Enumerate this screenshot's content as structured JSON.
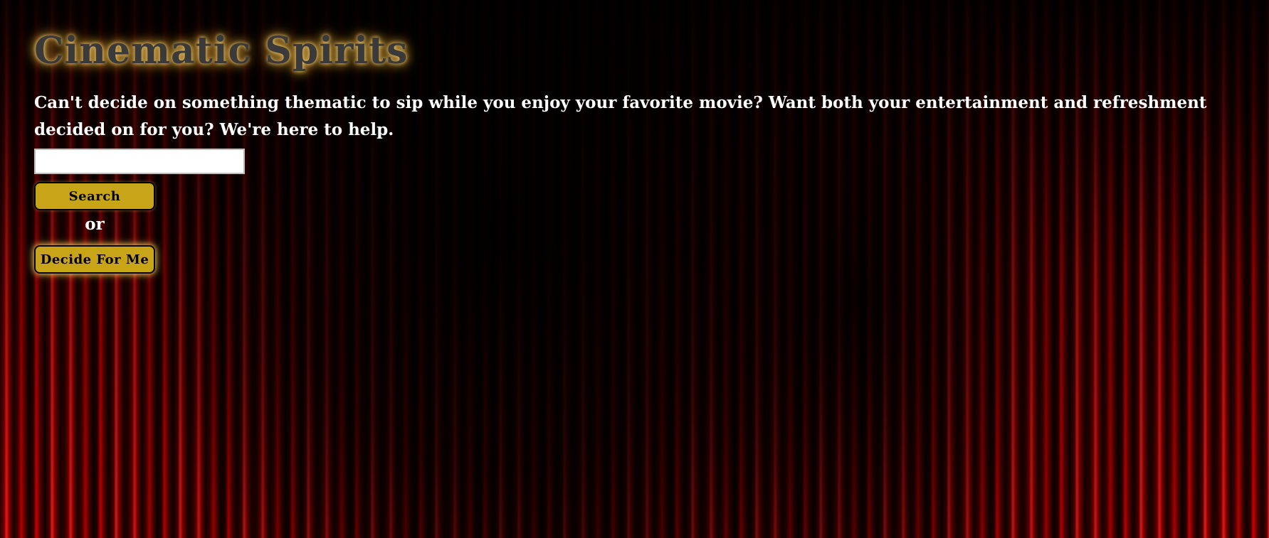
{
  "header": {
    "title": "Cinematic Spirits"
  },
  "intro": {
    "text": "Can't decide on something thematic to sip while you enjoy your favorite movie? Want both your entertainment and refreshment decided on for you? We're here to help."
  },
  "search": {
    "value": "",
    "placeholder": "",
    "button_label": "Search"
  },
  "separator": {
    "text": "or"
  },
  "decide": {
    "button_label": "Decide For Me"
  },
  "colors": {
    "button_gold": "#c8a418",
    "title_glow": "#d9a840",
    "curtain_red": "#c40000"
  }
}
